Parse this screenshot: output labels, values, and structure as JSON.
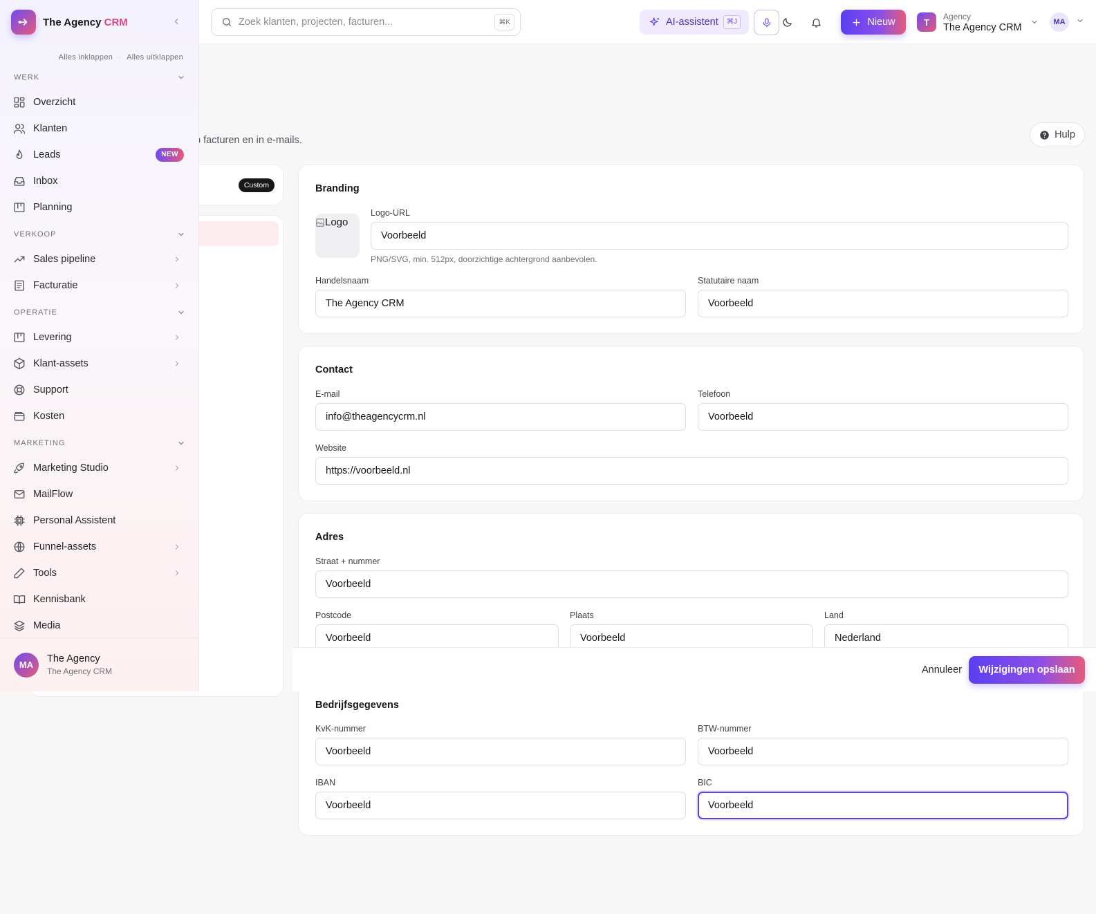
{
  "sidebar": {
    "brand_name": "The Agency",
    "brand_accent": "CRM",
    "collapse_all": "Alles inklappen",
    "expand_all": "Alles uitklappen",
    "sections": [
      {
        "title": "WERK"
      },
      {
        "title": "VERKOOP"
      },
      {
        "title": "OPERATIE"
      },
      {
        "title": "MARKETING"
      }
    ],
    "items": [
      {
        "label": "Overzicht",
        "icon": "grid-icon"
      },
      {
        "label": "Klanten",
        "icon": "users-icon"
      },
      {
        "label": "Leads",
        "icon": "flame-icon",
        "badge": "NEW"
      },
      {
        "label": "Inbox",
        "icon": "inbox-icon"
      },
      {
        "label": "Planning",
        "icon": "kanban-icon"
      },
      {
        "label": "Sales pipeline",
        "icon": "trending-up-icon"
      },
      {
        "label": "Facturatie",
        "icon": "receipt-icon"
      },
      {
        "label": "Levering",
        "icon": "kanban-icon"
      },
      {
        "label": "Klant-assets",
        "icon": "box-icon"
      },
      {
        "label": "Support",
        "icon": "lifebuoy-icon"
      },
      {
        "label": "Kosten",
        "icon": "wallet-icon"
      },
      {
        "label": "Marketing Studio",
        "icon": "rocket-icon"
      },
      {
        "label": "MailFlow",
        "icon": "mail-icon"
      },
      {
        "label": "Personal Assistent",
        "icon": "cpu-icon"
      },
      {
        "label": "Funnel-assets",
        "icon": "globe-icon"
      },
      {
        "label": "Tools",
        "icon": "pen-icon"
      },
      {
        "label": "Kennisbank",
        "icon": "book-icon"
      },
      {
        "label": "Media",
        "icon": "layers-icon"
      }
    ],
    "footer": {
      "initials": "MA",
      "name": "The Agency",
      "sub": "The Agency CRM"
    }
  },
  "topbar": {
    "search_placeholder": "Zoek klanten, projecten, facturen...",
    "search_kbd": "⌘K",
    "ai_label": "AI-assistent",
    "ai_kbd": "⌘J",
    "new_label": "Nieuw",
    "workspace_kind": "Agency",
    "workspace_name": "The Agency CRM",
    "workspace_initial": "T",
    "user_initials": "MA"
  },
  "page": {
    "subtitle_fragment": "p facturen en in e-mails.",
    "help_label": "Hulp",
    "custom_badge": "Custom"
  },
  "branding": {
    "title": "Branding",
    "logo_alt": "Logo",
    "logo_url_label": "Logo-URL",
    "logo_url_value": "Voorbeeld",
    "logo_hint": "PNG/SVG, min. 512px, doorzichtige achtergrond aanbevolen.",
    "trade_name_label": "Handelsnaam",
    "trade_name_value": "The Agency CRM",
    "legal_name_label": "Statutaire naam",
    "legal_name_value": "Voorbeeld"
  },
  "contact": {
    "title": "Contact",
    "email_label": "E-mail",
    "email_value": "info@theagencycrm.nl",
    "phone_label": "Telefoon",
    "phone_value": "Voorbeeld",
    "website_label": "Website",
    "website_value": "https://voorbeeld.nl"
  },
  "address": {
    "title": "Adres",
    "street_label": "Straat + nummer",
    "street_value": "Voorbeeld",
    "postcode_label": "Postcode",
    "postcode_value": "Voorbeeld",
    "city_label": "Plaats",
    "city_value": "Voorbeeld",
    "country_label": "Land",
    "country_value": "Nederland"
  },
  "company": {
    "title": "Bedrijfsgegevens",
    "kvk_label": "KvK-nummer",
    "kvk_value": "Voorbeeld",
    "vat_label": "BTW-nummer",
    "vat_value": "Voorbeeld",
    "iban_label": "IBAN",
    "iban_value": "Voorbeeld",
    "bic_label": "BIC",
    "bic_value": "Voorbeeld"
  },
  "savebar": {
    "cancel_label": "Annuleer",
    "save_label": "Wijzigingen opslaan"
  },
  "colors": {
    "accent": "#5b3ff0",
    "accent_pink": "#e65b7a"
  }
}
